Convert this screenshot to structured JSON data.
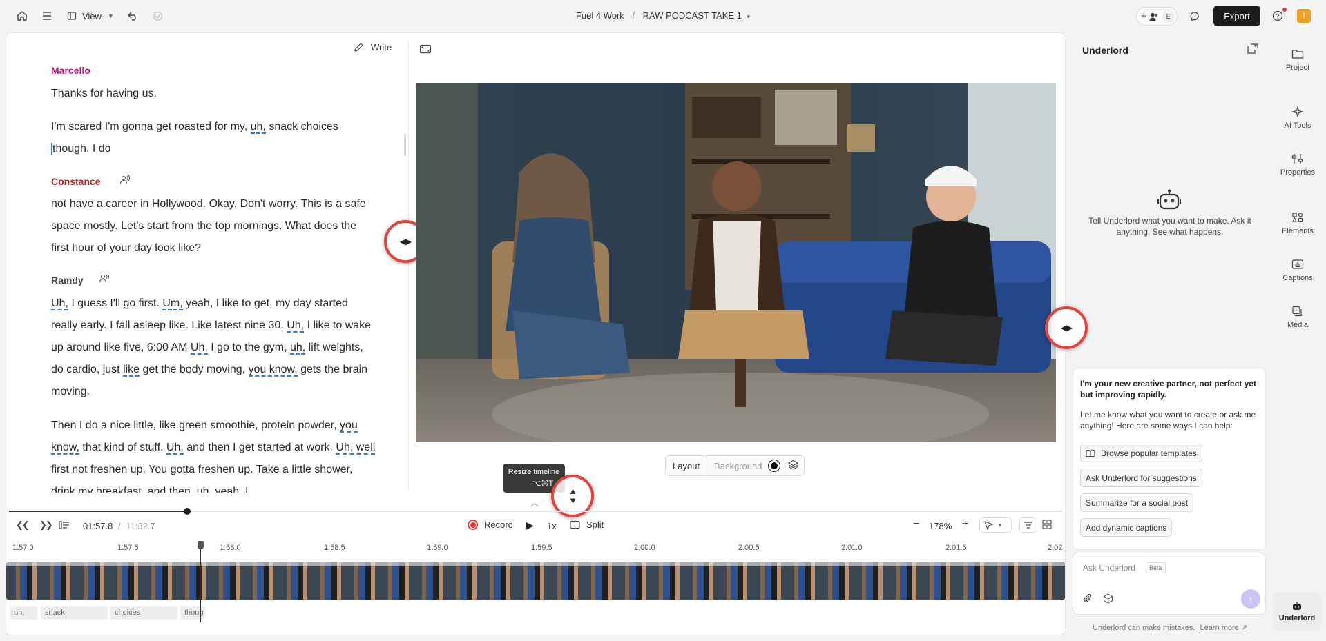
{
  "topbar": {
    "view_label": "View",
    "project_name": "Fuel 4 Work",
    "separator": "/",
    "composition_name": "RAW PODCAST TAKE 1",
    "avatar_initial": "E",
    "export_label": "Export",
    "user_initial": "!"
  },
  "editor": {
    "write_label": "Write",
    "transcript": {
      "speaker1": "Marcello",
      "p1": "Thanks for having us.",
      "p2_line1": "I'm scared I'm gonna get roasted for my,",
      "p2_uh": "uh,",
      "p2_line1_end": "snack choices",
      "p2_line2": "though. I do",
      "speaker2": "Constance",
      "p3": "not have a career in Hollywood. Okay. Don't worry. This is a safe space mostly. Let's start from the top mornings. What does the first hour of your day look like?",
      "speaker3": "Ramdy",
      "p4_uh1": "Uh,",
      "p4_a": " I guess I'll go first. ",
      "p4_um": "Um,",
      "p4_b": " yeah, I like to get, my day started really early. I fall asleep like. Like latest nine 30. ",
      "p4_uh2": "Uh,",
      "p4_c": " I like to wake up around like five, 6:00 AM ",
      "p4_uh3": "Uh,",
      "p4_d": " I go to the gym, ",
      "p4_uh4": "uh,",
      "p4_e": " lift weights, do cardio, just ",
      "p4_like": "like",
      "p4_f": " get the body moving, ",
      "p4_youknow": "you know,",
      "p4_g": " gets the brain moving.",
      "p5_a": "Then I do a nice little, like green smoothie, protein powder, ",
      "p5_youknow": "you know,",
      "p5_b": " that kind of stuff. ",
      "p5_uh1": "Uh,",
      "p5_c": " and then I get started at work. ",
      "p5_uhwell": "Uh, well",
      "p5_d": " first not freshen up. You gotta freshen up. Take a little shower, drink my breakfast, and then, uh, yeah, I,"
    },
    "layout_label": "Layout",
    "background_label": "Background",
    "tooltip": {
      "title": "Resize timeline",
      "shortcut": "⌥⌘T"
    }
  },
  "timeline": {
    "current_time": "01:57.8",
    "time_separator": "/",
    "total_time": "11:32.7",
    "record_label": "Record",
    "speed_label": "1x",
    "split_label": "Split",
    "zoom_label": "178%",
    "ruler": [
      "1:57.0",
      "1:57.5",
      "1:58.0",
      "1:58.5",
      "1:59.0",
      "1:59.5",
      "2:00.0",
      "2:00.5",
      "2:01.0",
      "2:01.5",
      "2:02"
    ],
    "words": [
      "uh,",
      "snack",
      "choices",
      "thoug"
    ]
  },
  "underlord": {
    "title": "Underlord",
    "intro": "Tell Underlord what you want to make. Ask it anything. See what happens.",
    "card_bold": "I'm your new creative partner, not perfect yet but improving rapidly.",
    "card_text": "Let me know what you want to create or ask me anything! Here are some ways I can help:",
    "suggestions": [
      "Browse popular templates",
      "Ask Underlord for suggestions",
      "Summarize for a social post",
      "Add dynamic captions"
    ],
    "input_placeholder": "Ask Underlord",
    "beta_label": "Beta",
    "disclaimer": "Underlord can make mistakes.",
    "learn_more": "Learn more ↗"
  },
  "rail": {
    "project": "Project",
    "ai_tools": "AI Tools",
    "properties": "Properties",
    "elements": "Elements",
    "captions": "Captions",
    "media": "Media",
    "underlord": "Underlord"
  },
  "colors": {
    "marcello": "#c2187b",
    "constance": "#b3261e",
    "ramdy": "#444444",
    "filler_underline": "#2f7fd1",
    "handle_ring": "#e2443c",
    "record": "#e53935"
  }
}
